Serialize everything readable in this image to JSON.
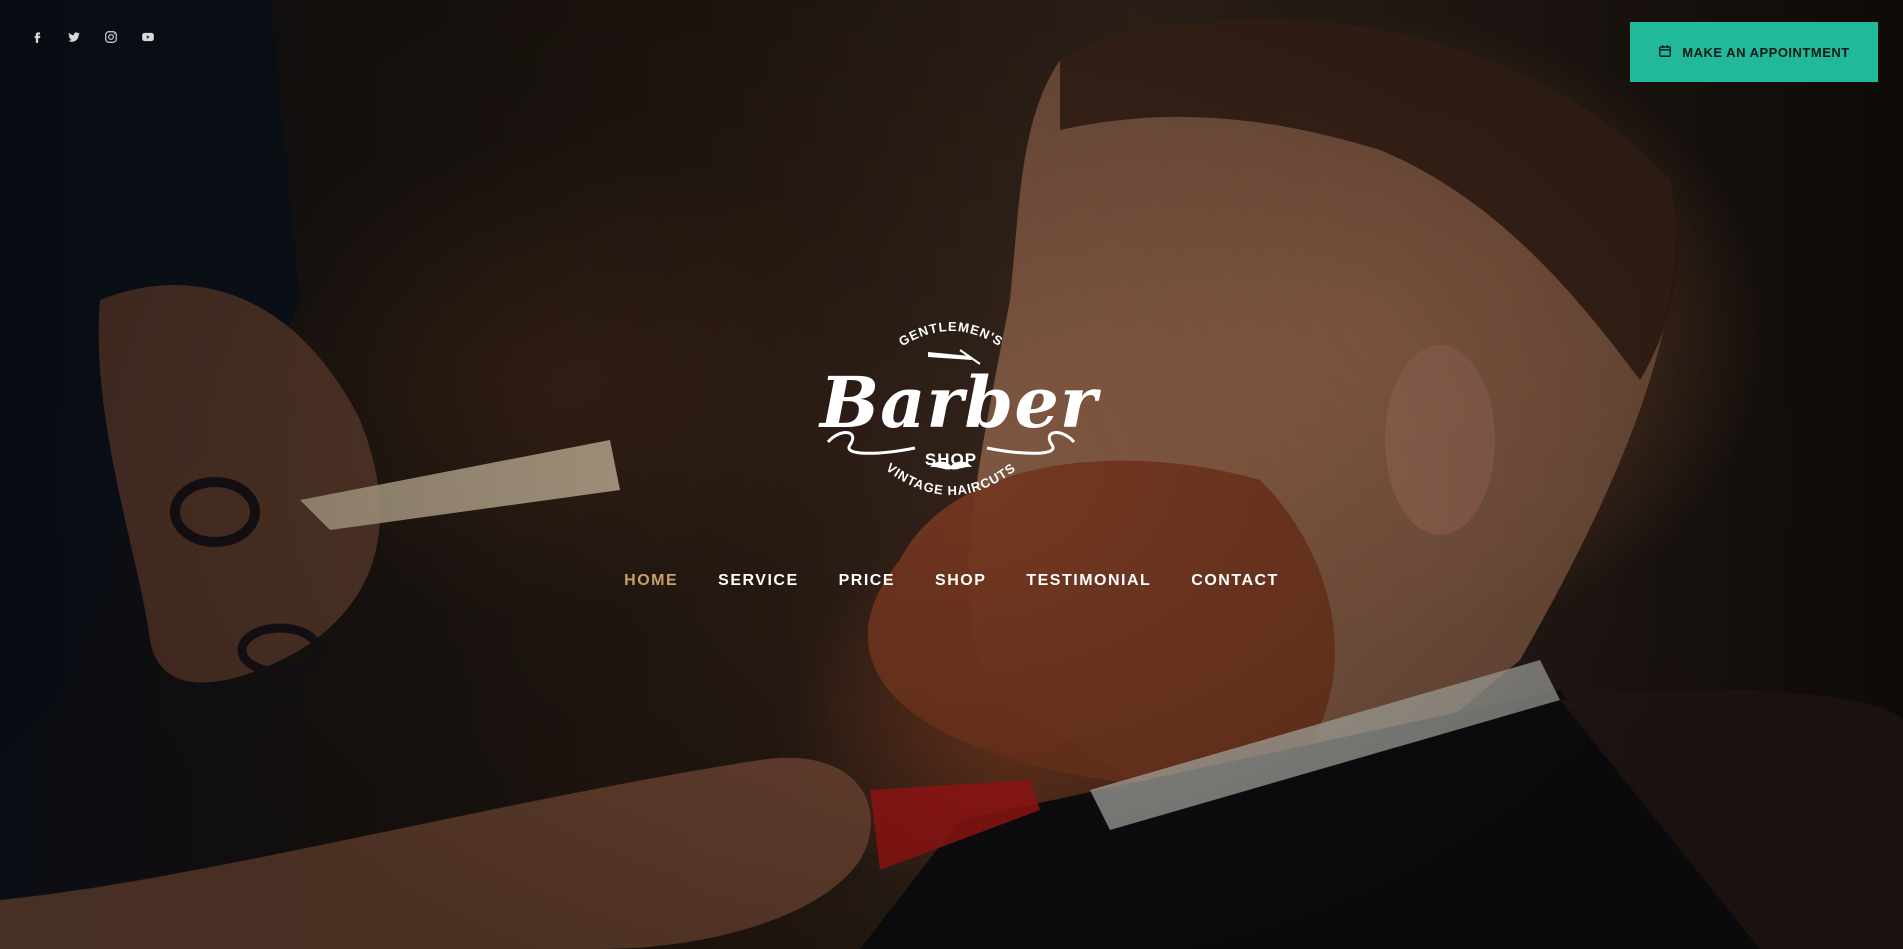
{
  "social": [
    {
      "name": "facebook-icon"
    },
    {
      "name": "twitter-icon"
    },
    {
      "name": "instagram-icon"
    },
    {
      "name": "youtube-icon"
    }
  ],
  "appointment": {
    "label": "MAKE AN APPOINTMENT",
    "icon": "calendar-icon",
    "color": "#22b99a"
  },
  "logo": {
    "top_arc": "GENTLEMEN'S",
    "script": "Barber",
    "shop": "SHOP",
    "bottom_arc": "VINTAGE HAIRCUTS"
  },
  "nav": {
    "active_color": "#c8a06a",
    "items": [
      {
        "label": "HOME",
        "active": true
      },
      {
        "label": "SERVICE",
        "active": false
      },
      {
        "label": "PRICE",
        "active": false
      },
      {
        "label": "SHOP",
        "active": false
      },
      {
        "label": "TESTIMONIAL",
        "active": false
      },
      {
        "label": "CONTACT",
        "active": false
      }
    ]
  }
}
